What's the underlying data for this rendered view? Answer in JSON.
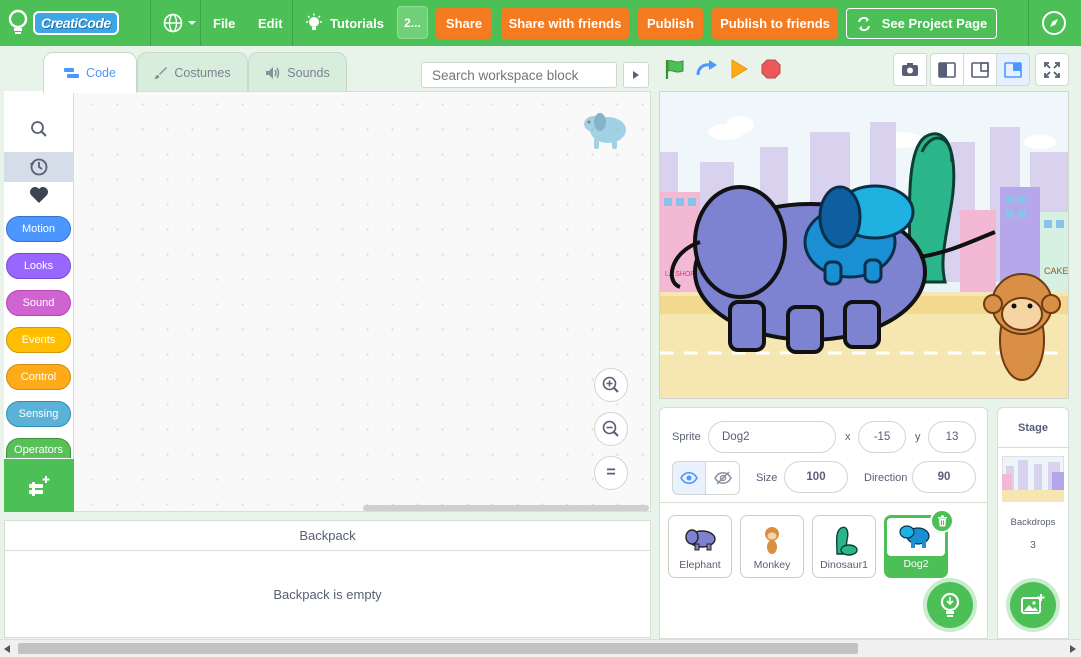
{
  "topbar": {
    "logo_text": "CreatiCode",
    "menu_file": "File",
    "menu_edit": "Edit",
    "menu_tutorials": "Tutorials",
    "project_badge": "2...",
    "share": "Share",
    "share_friends": "Share with friends",
    "publish": "Publish",
    "publish_friends": "Publish to friends",
    "see_project_page": "See Project Page",
    "accent": "#4cbf56",
    "button_color": "#f47b1f"
  },
  "tabs": {
    "code": "Code",
    "costumes": "Costumes",
    "sounds": "Sounds",
    "active": "Code"
  },
  "search": {
    "placeholder": "Search workspace block"
  },
  "categories": [
    {
      "label": "Motion",
      "color": "#4c97ff"
    },
    {
      "label": "Looks",
      "color": "#9966ff"
    },
    {
      "label": "Sound",
      "color": "#cf63cf"
    },
    {
      "label": "Events",
      "color": "#ffbf00"
    },
    {
      "label": "Control",
      "color": "#ffab19"
    },
    {
      "label": "Sensing",
      "color": "#5cb1d6"
    },
    {
      "label": "Operators",
      "color": "#59c059"
    }
  ],
  "zoom": {
    "reset_symbol": "="
  },
  "backpack": {
    "title": "Backpack",
    "empty_text": "Backpack is empty"
  },
  "sprite": {
    "label": "Sprite",
    "name": "Dog2",
    "x_label": "x",
    "x": "-15",
    "y_label": "y",
    "y": "13",
    "size_label": "Size",
    "size": "100",
    "direction_label": "Direction",
    "direction": "90"
  },
  "sprites": [
    {
      "name": "Elephant",
      "selected": false
    },
    {
      "name": "Monkey",
      "selected": false
    },
    {
      "name": "Dinosaur1",
      "selected": false
    },
    {
      "name": "Dog2",
      "selected": true
    }
  ],
  "stage_panel": {
    "title": "Stage",
    "backdrops_label": "Backdrops",
    "backdrops_count": "3"
  },
  "stage_scene": {
    "shop_sign": "LA SHOP",
    "cake_sign": "CAKE"
  }
}
